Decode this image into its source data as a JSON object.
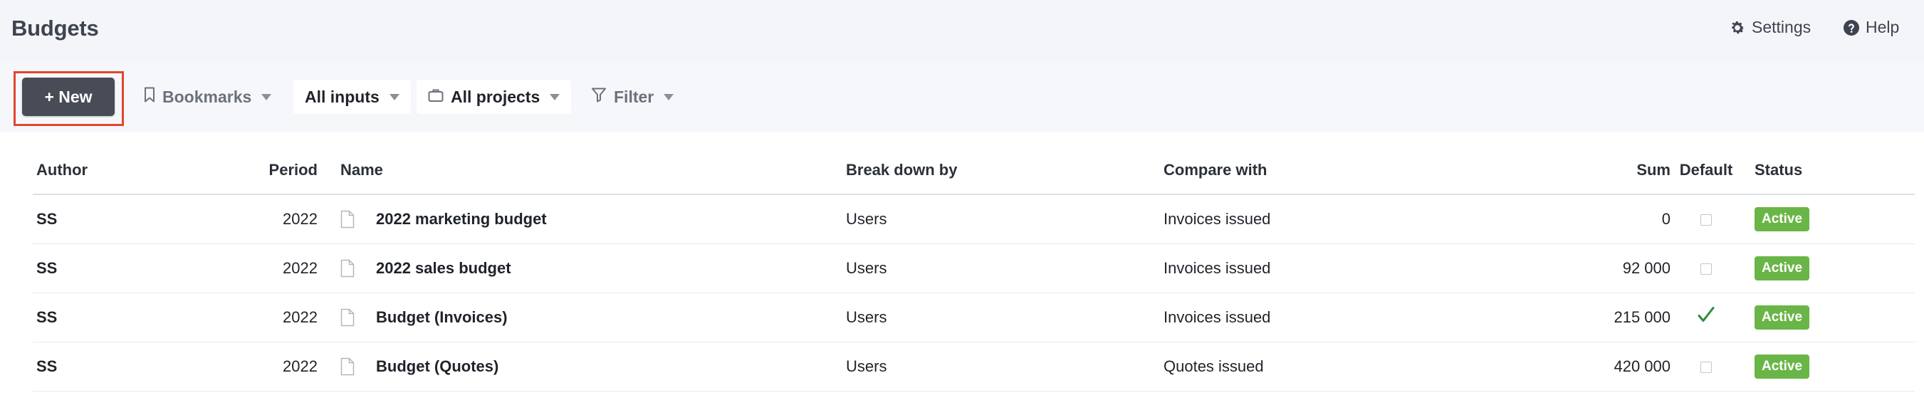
{
  "page": {
    "title": "Budgets"
  },
  "header": {
    "settings_label": "Settings",
    "settings_icon": "gear-icon",
    "help_label": "Help",
    "help_icon": "help-icon"
  },
  "toolbar": {
    "new_label": "+ New",
    "bookmarks_label": "Bookmarks",
    "inputs_label": "All inputs",
    "projects_label": "All projects",
    "filter_label": "Filter"
  },
  "table": {
    "columns": {
      "author": "Author",
      "period": "Period",
      "name": "Name",
      "break_down_by": "Break down by",
      "compare_with": "Compare with",
      "sum": "Sum",
      "default": "Default",
      "status": "Status"
    },
    "rows": [
      {
        "author": "SS",
        "period": "2022",
        "name": "2022 marketing budget",
        "break_down_by": "Users",
        "compare_with": "Invoices issued",
        "sum": "0",
        "is_default": false,
        "status": "Active"
      },
      {
        "author": "SS",
        "period": "2022",
        "name": "2022 sales budget",
        "break_down_by": "Users",
        "compare_with": "Invoices issued",
        "sum": "92 000",
        "is_default": false,
        "status": "Active"
      },
      {
        "author": "SS",
        "period": "2022",
        "name": "Budget (Invoices)",
        "break_down_by": "Users",
        "compare_with": "Invoices issued",
        "sum": "215 000",
        "is_default": true,
        "status": "Active"
      },
      {
        "author": "SS",
        "period": "2022",
        "name": "Budget (Quotes)",
        "break_down_by": "Users",
        "compare_with": "Quotes issued",
        "sum": "420 000",
        "is_default": false,
        "status": "Active"
      }
    ]
  },
  "colors": {
    "status_active": "#6ab547",
    "new_button": "#474c57",
    "highlight": "#e2462f"
  }
}
